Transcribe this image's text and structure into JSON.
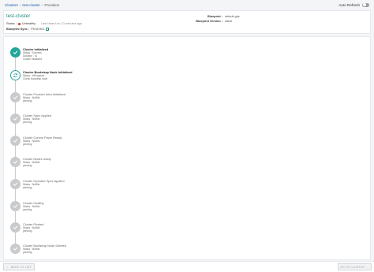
{
  "breadcrumb": {
    "items": [
      "Clusters",
      "test-cluster",
      "Provision"
    ]
  },
  "auto_refresh": {
    "label": "Auto Refresh",
    "enabled": false
  },
  "cluster": {
    "name": "test-cluster",
    "status_label": "Status :",
    "status_value": "Unhealthy",
    "updated_text": "Last Heard on: 21 minutes ago",
    "blueprint_sync_label": "Blueprint Sync :",
    "blueprint_sync_value": "PENDING",
    "blueprint_label": "Blueprint :",
    "blueprint_value": "default-gke",
    "blueprint_version_label": "Blueprint Version :",
    "blueprint_version_value": "latest"
  },
  "steps": [
    {
      "title": "Cluster Initialized",
      "state": "done",
      "lines": [
        "Status : Success",
        "Duration : 1s",
        "Cluster initialized"
      ]
    },
    {
      "title": "Cluster Bootstrap Node Initialized",
      "state": "progress",
      "lines": [
        "Status : InProgress",
        "Check bootstrap node"
      ]
    },
    {
      "title": "Cluster Provider Infra Initialized",
      "state": "pending",
      "lines": [
        "Status : NotSet",
        "pending"
      ]
    },
    {
      "title": "Cluster Spec Applied",
      "state": "pending",
      "lines": [
        "Status : NotSet",
        "pending"
      ]
    },
    {
      "title": "Cluster Control Plane Ready",
      "state": "pending",
      "lines": [
        "Status : NotSet",
        "pending"
      ]
    },
    {
      "title": "Cluster Nodes ready",
      "state": "pending",
      "lines": [
        "Status : NotSet",
        "pending"
      ]
    },
    {
      "title": "Cluster Operator Spec Applied",
      "state": "pending",
      "lines": [
        "Status : NotSet",
        "pending"
      ]
    },
    {
      "title": "Cluster Healthy",
      "state": "pending",
      "lines": [
        "Status : NotSet",
        "pending"
      ]
    },
    {
      "title": "Cluster Pivoted",
      "state": "pending",
      "lines": [
        "Status : NotSet",
        "pending"
      ]
    },
    {
      "title": "Cluster Bootstrap Node Deleted",
      "state": "pending",
      "lines": [
        "Status : NotSet",
        "pending"
      ]
    }
  ],
  "footer": {
    "back_label": "BACK TO LIST",
    "go_label": "GO TO CLUSTER"
  },
  "colors": {
    "accent": "#26a69a",
    "error": "#d32f2f",
    "link": "#1a5bab",
    "pending": "#c8cacc"
  },
  "icons": {
    "done": "check-icon",
    "progress": "sync-icon",
    "pending": "check-icon"
  }
}
